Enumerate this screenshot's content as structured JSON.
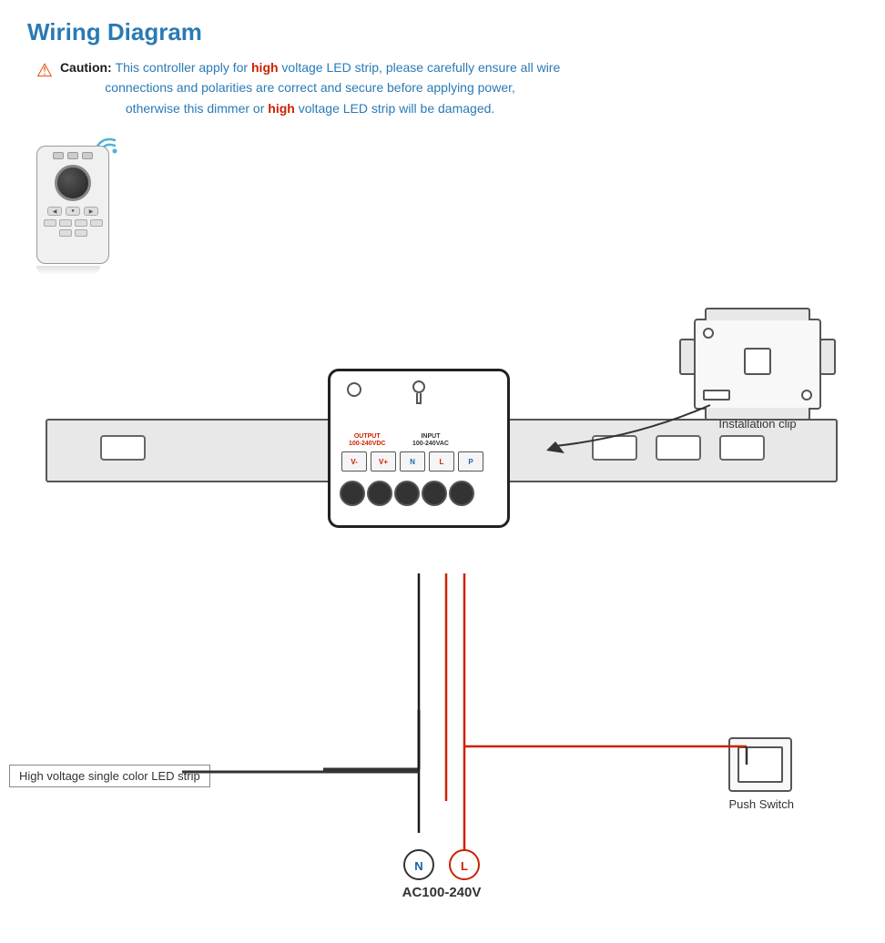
{
  "title": "Wiring Diagram",
  "caution": {
    "label": "Caution:",
    "text": "This controller apply for high voltage LED strip, please carefully ensure all wire connections and polarities are correct and secure before applying power, otherwise this dimmer or high voltage LED strip will be damaged.",
    "highlight_words": [
      "high",
      "high"
    ]
  },
  "labels": {
    "installation_clip": "Installation clip",
    "push_switch": "Push Switch",
    "led_strip": "High voltage single color LED strip",
    "ac_input": "AC100-240V",
    "output_label": "OUTPUT\n100-240VDC",
    "input_label": "INPUT\n100-240VAC",
    "terminals": [
      "V-",
      "V+",
      "N",
      "L",
      "P"
    ]
  }
}
